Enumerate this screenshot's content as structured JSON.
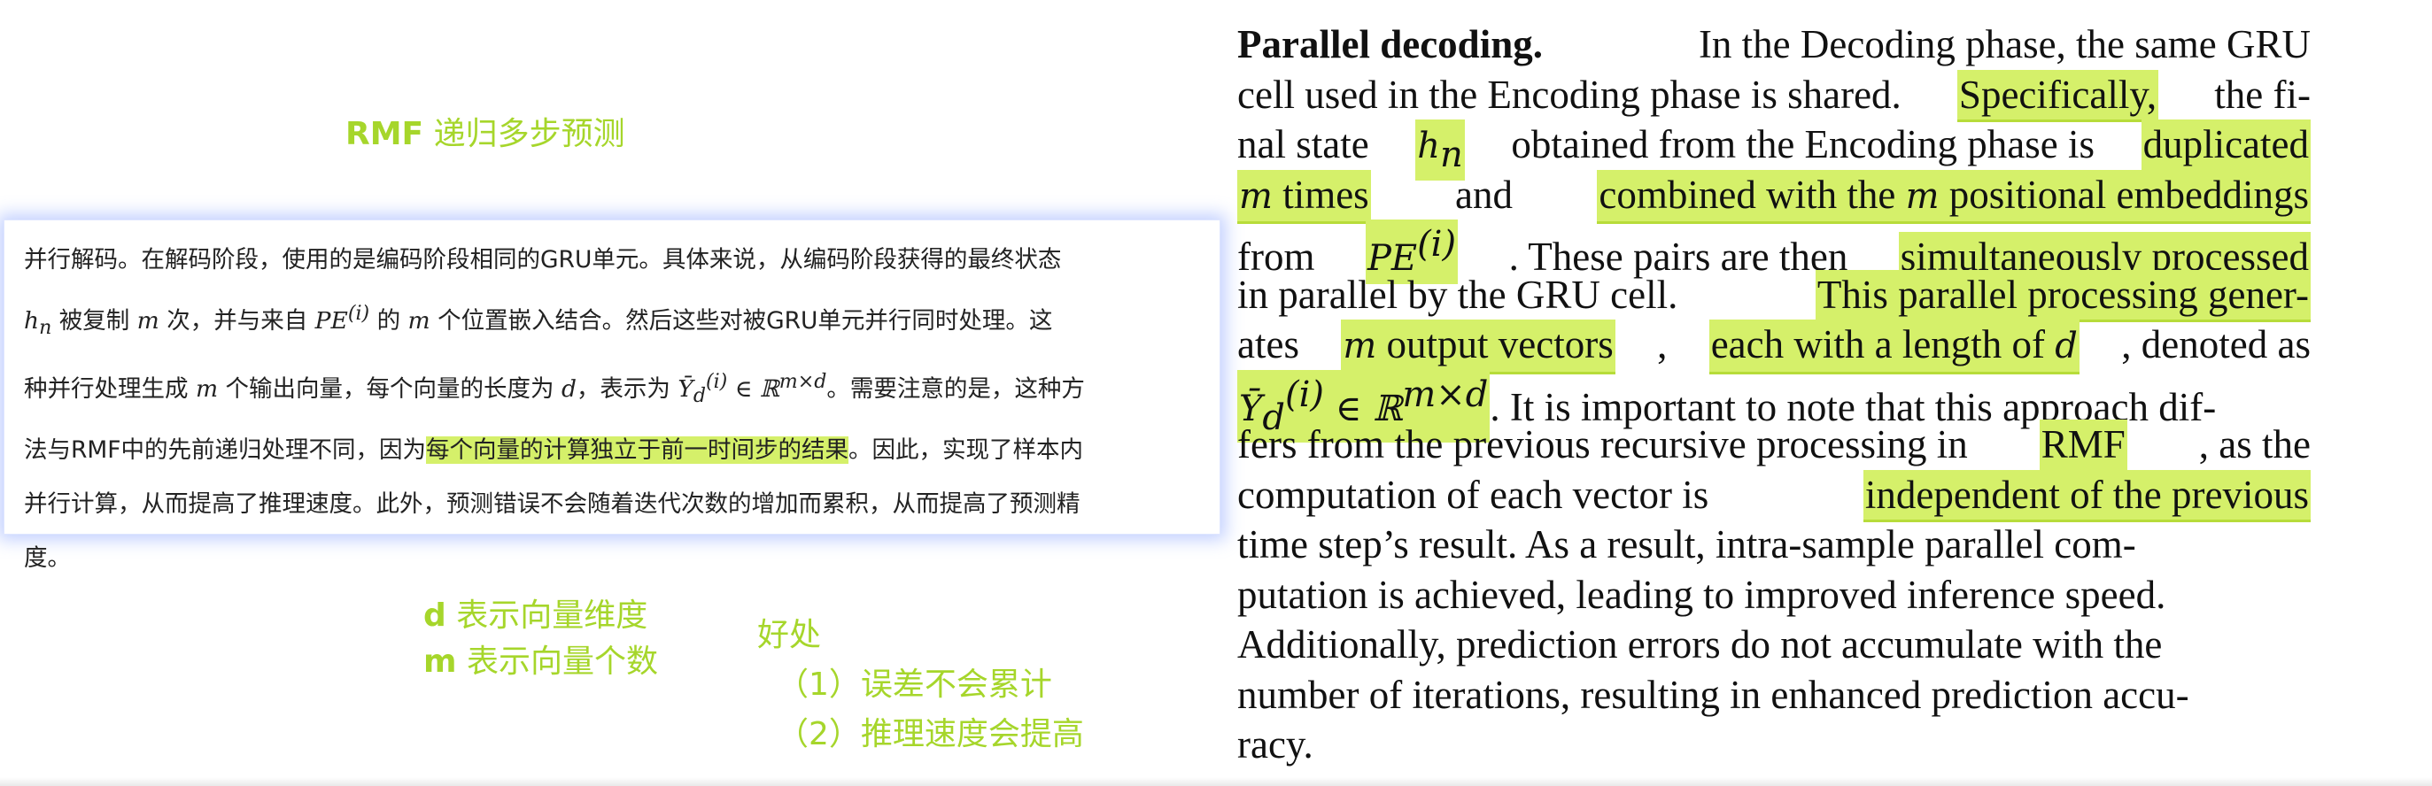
{
  "note_title": {
    "bold": "RMF",
    "rest": " 递归多步预测"
  },
  "zh_paragraph": {
    "l1": "并行解码。在解码阶段，使用的是编码阶段相同的GRU单元。具体来说，从编码阶段获得的最终状态",
    "l2a": " 被复制 ",
    "l2b": " 次，并与来自 ",
    "l2c": " 的 ",
    "l2d": " 个位置嵌入结合。然后这些对被GRU单元并行同时处理。这",
    "l3a": "种并行处理生成 ",
    "l3b": " 个输出向量，每个向量的长度为 ",
    "l3c": "，表示为 ",
    "l3d": "。需要注意的是，这种方",
    "l4a": "法与RMF中的先前递归处理不同，因为",
    "l4hl": "每个向量的计算独立于前一时间步的结果",
    "l4b": "。因此，实现了样本内",
    "l5": "并行计算，从而提高了推理速度。此外，预测错误不会随着迭代次数的增加而累积，从而提高了预测精",
    "l6": "度。",
    "math": {
      "hn": "h",
      "hn_sub": "n",
      "m": "m",
      "pe": "PE",
      "pe_sup": "(i)",
      "d": "d",
      "ybar": "Ȳ",
      "ybar_sup": "(i)",
      "ybar_sub": "d",
      "in": " ∈ ℝ",
      "dims": "m×d"
    }
  },
  "meaning_notes": [
    {
      "bold": "d",
      "rest": " 表示向量维度"
    },
    {
      "bold": "m",
      "rest": " 表示向量个数"
    }
  ],
  "benefits": {
    "title": "好处",
    "items": [
      "（1）误差不会累计",
      "（2）推理速度会提高"
    ]
  },
  "paper": {
    "heading": "Parallel decoding.",
    "lines": [
      [
        "In the Decoding phase, the same GRU"
      ],
      [
        "cell used in the Encoding phase is shared.",
        "Specifically,",
        "the fi-"
      ],
      [
        "nal state",
        "obtained from the Encoding phase is",
        "duplicated"
      ],
      [
        "times",
        "and",
        "combined with the",
        "positional embeddings"
      ],
      [
        "from",
        ". These pairs are then",
        "simultaneously processed"
      ],
      [
        "in parallel by the GRU cell.",
        "This parallel processing gener-"
      ],
      [
        "ates",
        "output vectors",
        ",",
        "each with a length of",
        ", denoted as"
      ],
      [
        ". It is important to note that this approach dif-"
      ],
      [
        "fers from the previous recursive processing in",
        "RMF",
        ", as the"
      ],
      [
        "computation of each vector is",
        "independent of the previous"
      ],
      [
        "time step’s result. As a result, intra-sample parallel com-"
      ],
      [
        "putation is achieved, leading to improved inference speed."
      ],
      [
        "Additionally, prediction errors do not accumulate with the"
      ],
      [
        "number of iterations, resulting in enhanced prediction accu-"
      ],
      [
        "racy."
      ]
    ]
  },
  "colors": {
    "accent_green": "#a6d62b",
    "highlight": "#d5f06a",
    "card_glow": "#7896ff"
  }
}
